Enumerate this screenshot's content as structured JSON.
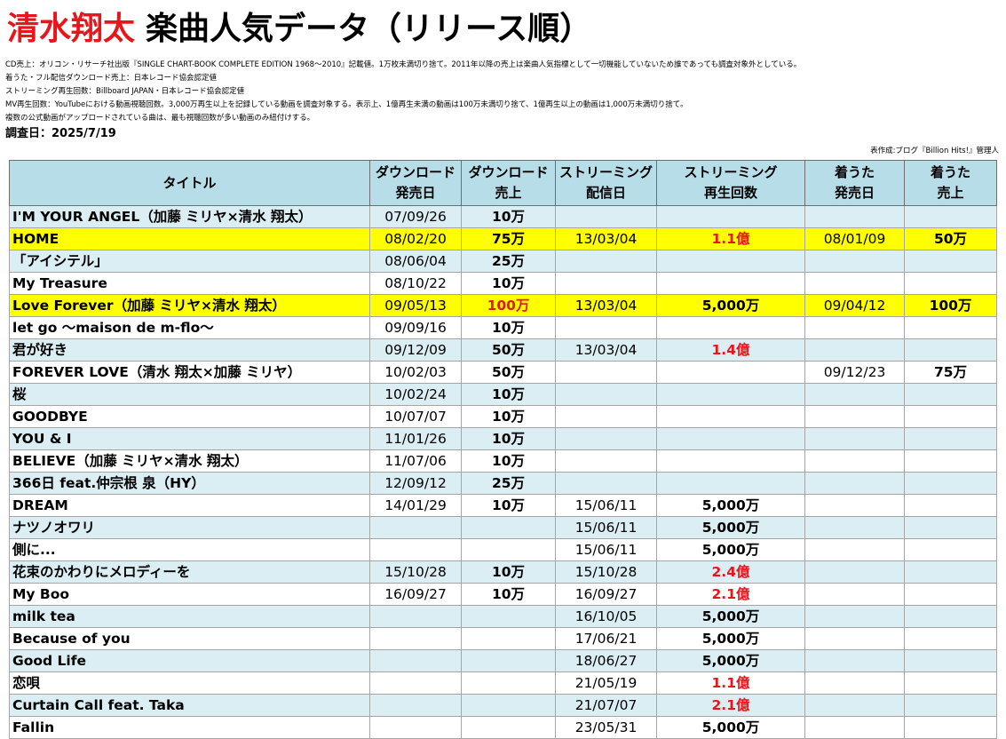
{
  "page": {
    "title_artist": "清水翔太",
    "title_rest": "楽曲人気データ（リリース順）",
    "notes": [
      "CD売上：オリコン・リサーチ社出版『SINGLE CHART-BOOK COMPLETE EDITION 1968～2010』記載値。1万枚未満切り捨て。2011年以降の売上は楽曲人気指標として一切機能していないため誰であっても調査対象外としている。",
      "着うた・フル配信ダウンロード売上：日本レコード協会認定値",
      "ストリーミング再生回数：Billboard JAPAN・日本レコード協会認定値",
      "MV再生回数：YouTubeにおける動画視聴回数。3,000万再生以上を記録している動画を調査対象する。表示上、1億再生未満の動画は100万未満切り捨て、1億再生以上の動画は1,000万未満切り捨て。",
      "複数の公式動画がアップロードされている曲は、最も視聴回数が多い動画のみ紐付けする。"
    ],
    "survey_date": "調査日：2025/7/19",
    "credit": "表作成:ブログ『Billion Hits!』管理人"
  },
  "table": {
    "headers": [
      "タイトル",
      "ダウンロード\n発売日",
      "ダウンロード\n売上",
      "ストリーミング\n配信日",
      "ストリーミング\n再生回数",
      "着うた\n発売日",
      "着うた\n売上"
    ],
    "rows": [
      {
        "title": "I'M YOUR ANGEL（加藤 ミリヤ×清水 翔太）",
        "dl_date": "07/09/26",
        "dl_sales": "10万",
        "st_date": "",
        "st_plays": "",
        "cu_date": "",
        "cu_sales": "",
        "hl": false,
        "dl_red": false,
        "st_red": false
      },
      {
        "title": "HOME",
        "dl_date": "08/02/20",
        "dl_sales": "75万",
        "st_date": "13/03/04",
        "st_plays": "1.1億",
        "cu_date": "08/01/09",
        "cu_sales": "50万",
        "hl": true,
        "dl_red": false,
        "st_red": true
      },
      {
        "title": "「アイシテル」",
        "dl_date": "08/06/04",
        "dl_sales": "25万",
        "st_date": "",
        "st_plays": "",
        "cu_date": "",
        "cu_sales": "",
        "hl": false,
        "dl_red": false,
        "st_red": false
      },
      {
        "title": "My Treasure",
        "dl_date": "08/10/22",
        "dl_sales": "10万",
        "st_date": "",
        "st_plays": "",
        "cu_date": "",
        "cu_sales": "",
        "hl": false,
        "dl_red": false,
        "st_red": false
      },
      {
        "title": "Love Forever（加藤 ミリヤ×清水 翔太）",
        "dl_date": "09/05/13",
        "dl_sales": "100万",
        "st_date": "13/03/04",
        "st_plays": "5,000万",
        "cu_date": "09/04/12",
        "cu_sales": "100万",
        "hl": true,
        "dl_red": true,
        "st_red": false
      },
      {
        "title": "let go ～maison de m-flo～",
        "dl_date": "09/09/16",
        "dl_sales": "10万",
        "st_date": "",
        "st_plays": "",
        "cu_date": "",
        "cu_sales": "",
        "hl": false,
        "dl_red": false,
        "st_red": false
      },
      {
        "title": "君が好き",
        "dl_date": "09/12/09",
        "dl_sales": "50万",
        "st_date": "13/03/04",
        "st_plays": "1.4億",
        "cu_date": "",
        "cu_sales": "",
        "hl": false,
        "dl_red": false,
        "st_red": true
      },
      {
        "title": "FOREVER LOVE（清水 翔太×加藤 ミリヤ）",
        "dl_date": "10/02/03",
        "dl_sales": "50万",
        "st_date": "",
        "st_plays": "",
        "cu_date": "09/12/23",
        "cu_sales": "75万",
        "hl": false,
        "dl_red": false,
        "st_red": false
      },
      {
        "title": "桜",
        "dl_date": "10/02/24",
        "dl_sales": "10万",
        "st_date": "",
        "st_plays": "",
        "cu_date": "",
        "cu_sales": "",
        "hl": false,
        "dl_red": false,
        "st_red": false
      },
      {
        "title": "GOODBYE",
        "dl_date": "10/07/07",
        "dl_sales": "10万",
        "st_date": "",
        "st_plays": "",
        "cu_date": "",
        "cu_sales": "",
        "hl": false,
        "dl_red": false,
        "st_red": false
      },
      {
        "title": "YOU & I",
        "dl_date": "11/01/26",
        "dl_sales": "10万",
        "st_date": "",
        "st_plays": "",
        "cu_date": "",
        "cu_sales": "",
        "hl": false,
        "dl_red": false,
        "st_red": false
      },
      {
        "title": "BELIEVE（加藤 ミリヤ×清水 翔太）",
        "dl_date": "11/07/06",
        "dl_sales": "10万",
        "st_date": "",
        "st_plays": "",
        "cu_date": "",
        "cu_sales": "",
        "hl": false,
        "dl_red": false,
        "st_red": false
      },
      {
        "title": "366日 feat.仲宗根 泉（HY）",
        "dl_date": "12/09/12",
        "dl_sales": "25万",
        "st_date": "",
        "st_plays": "",
        "cu_date": "",
        "cu_sales": "",
        "hl": false,
        "dl_red": false,
        "st_red": false
      },
      {
        "title": "DREAM",
        "dl_date": "14/01/29",
        "dl_sales": "10万",
        "st_date": "15/06/11",
        "st_plays": "5,000万",
        "cu_date": "",
        "cu_sales": "",
        "hl": false,
        "dl_red": false,
        "st_red": false
      },
      {
        "title": "ナツノオワリ",
        "dl_date": "",
        "dl_sales": "",
        "st_date": "15/06/11",
        "st_plays": "5,000万",
        "cu_date": "",
        "cu_sales": "",
        "hl": false,
        "dl_red": false,
        "st_red": false
      },
      {
        "title": "側に...",
        "dl_date": "",
        "dl_sales": "",
        "st_date": "15/06/11",
        "st_plays": "5,000万",
        "cu_date": "",
        "cu_sales": "",
        "hl": false,
        "dl_red": false,
        "st_red": false
      },
      {
        "title": "花束のかわりにメロディーを",
        "dl_date": "15/10/28",
        "dl_sales": "10万",
        "st_date": "15/10/28",
        "st_plays": "2.4億",
        "cu_date": "",
        "cu_sales": "",
        "hl": false,
        "dl_red": false,
        "st_red": true
      },
      {
        "title": "My Boo",
        "dl_date": "16/09/27",
        "dl_sales": "10万",
        "st_date": "16/09/27",
        "st_plays": "2.1億",
        "cu_date": "",
        "cu_sales": "",
        "hl": false,
        "dl_red": false,
        "st_red": true
      },
      {
        "title": "milk tea",
        "dl_date": "",
        "dl_sales": "",
        "st_date": "16/10/05",
        "st_plays": "5,000万",
        "cu_date": "",
        "cu_sales": "",
        "hl": false,
        "dl_red": false,
        "st_red": false
      },
      {
        "title": "Because of you",
        "dl_date": "",
        "dl_sales": "",
        "st_date": "17/06/21",
        "st_plays": "5,000万",
        "cu_date": "",
        "cu_sales": "",
        "hl": false,
        "dl_red": false,
        "st_red": false
      },
      {
        "title": "Good Life",
        "dl_date": "",
        "dl_sales": "",
        "st_date": "18/06/27",
        "st_plays": "5,000万",
        "cu_date": "",
        "cu_sales": "",
        "hl": false,
        "dl_red": false,
        "st_red": false
      },
      {
        "title": "恋唄",
        "dl_date": "",
        "dl_sales": "",
        "st_date": "21/05/19",
        "st_plays": "1.1億",
        "cu_date": "",
        "cu_sales": "",
        "hl": false,
        "dl_red": false,
        "st_red": true
      },
      {
        "title": "Curtain Call feat. Taka",
        "dl_date": "",
        "dl_sales": "",
        "st_date": "21/07/07",
        "st_plays": "2.1億",
        "cu_date": "",
        "cu_sales": "",
        "hl": false,
        "dl_red": false,
        "st_red": true
      },
      {
        "title": "Fallin",
        "dl_date": "",
        "dl_sales": "",
        "st_date": "23/05/31",
        "st_plays": "5,000万",
        "cu_date": "",
        "cu_sales": "",
        "hl": false,
        "dl_red": false,
        "st_red": false
      }
    ]
  },
  "colors": {
    "title_red": "#e8151b",
    "header_bg": "#b7dde8",
    "stripe_bg": "#daeef3",
    "highlight_bg": "#ffff00",
    "value_red": "#e8151b"
  }
}
